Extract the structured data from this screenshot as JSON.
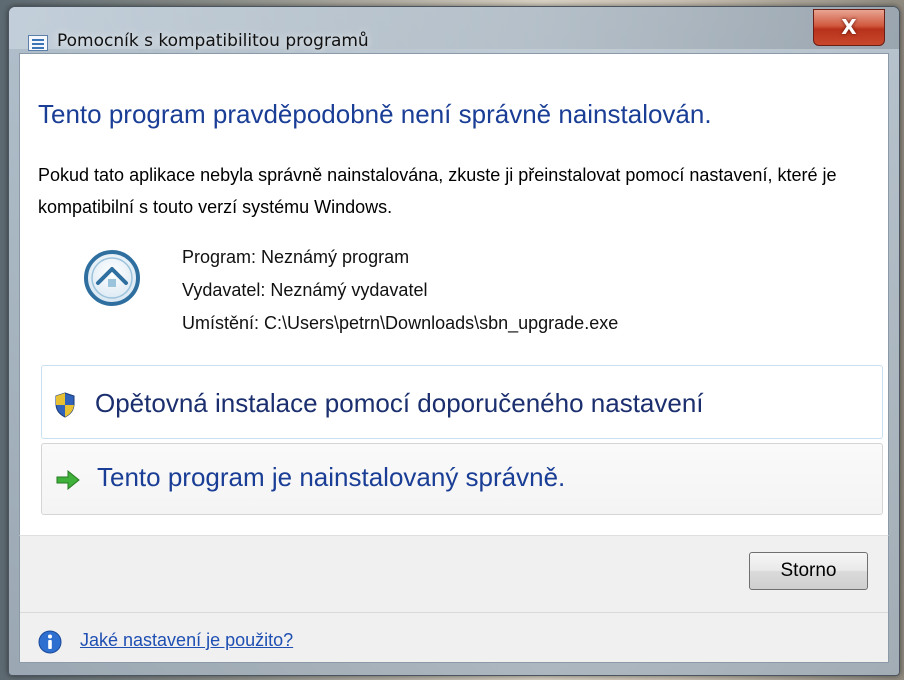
{
  "window": {
    "title": "Pomocník s kompatibilitou programů",
    "close_label": "X"
  },
  "content": {
    "heading": "Tento program pravděpodobně není správně nainstalován.",
    "description": "Pokud tato aplikace nebyla správně nainstalována, zkuste ji přeinstalovat pomocí nastavení, které je kompatibilní s touto verzí systému Windows.",
    "program_info": [
      "Program: Neznámý program",
      "Vydavatel: Neznámý vydavatel",
      "Umístění: C:\\Users\\petrn\\Downloads\\sbn_upgrade.exe"
    ]
  },
  "options": [
    {
      "label": "Opětovná instalace pomocí doporučeného nastavení",
      "icon": "shield-icon"
    },
    {
      "label": "Tento program je nainstalovaný správně.",
      "icon": "green-arrow-icon"
    }
  ],
  "footer": {
    "cancel_label": "Storno",
    "help_link": "Jaké nastavení je použito?"
  },
  "colors": {
    "heading": "#1a3e96",
    "link": "#1e4fb2",
    "close_button": "#c8482b"
  }
}
